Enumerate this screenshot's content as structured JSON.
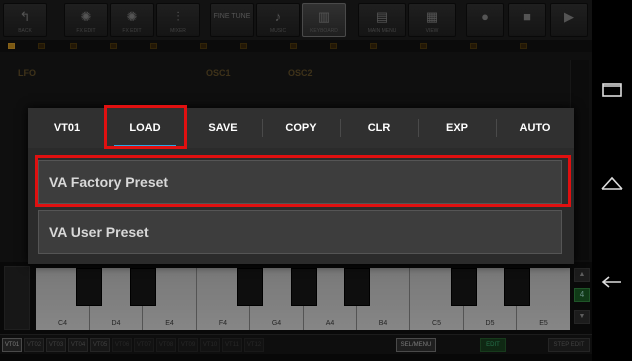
{
  "toolbar": {
    "buttons": [
      {
        "label": "BACK",
        "icon": "back-icon",
        "glyph": "↰"
      },
      {
        "label": "FX EDIT",
        "icon": "fx-icon",
        "glyph": "✺"
      },
      {
        "label": "FX EDIT",
        "icon": "fx2-icon",
        "glyph": "✺"
      },
      {
        "label": "MIXER",
        "icon": "mixer-icon",
        "glyph": "⫶"
      },
      {
        "label": "",
        "icon": "finetune-icon",
        "glyph": "FINE TUNE"
      },
      {
        "label": "MUSIC",
        "icon": "music-icon",
        "glyph": "♪"
      },
      {
        "label": "KEYBOARD",
        "icon": "keyboard-icon",
        "glyph": "▥"
      },
      {
        "label": "MAIN MENU",
        "icon": "mainmenu-icon",
        "glyph": "▤"
      },
      {
        "label": "VIEW",
        "icon": "view-icon",
        "glyph": "▦"
      },
      {
        "label": "",
        "icon": "record-icon",
        "glyph": "●"
      },
      {
        "label": "",
        "icon": "stop-icon",
        "glyph": "■"
      },
      {
        "label": "",
        "icon": "play-icon",
        "glyph": "▶"
      }
    ]
  },
  "background": {
    "lfo_label": "LFO",
    "osc1_label": "OSC1",
    "osc2_label": "OSC2"
  },
  "dialog": {
    "tabs": [
      "VT01",
      "LOAD",
      "SAVE",
      "COPY",
      "CLR",
      "EXP",
      "AUTO"
    ],
    "selected_tab": "LOAD",
    "items": [
      "VA Factory Preset",
      "VA User Preset"
    ],
    "accent": "#2aa7e4",
    "highlight": "#e01010"
  },
  "keyboard": {
    "keys": [
      "C4",
      "D4",
      "E4",
      "F4",
      "G4",
      "A4",
      "B4",
      "C5",
      "D5",
      "E5"
    ],
    "octave": "4"
  },
  "tracks": {
    "items": [
      "VT01",
      "VT02",
      "VT03",
      "VT04",
      "VT05",
      "VT06",
      "VT07",
      "VT08",
      "VT09",
      "VT10",
      "VT11",
      "VT12"
    ],
    "sel_menu": "SEL/MENU",
    "edit": "EDIT",
    "step_edit": "STEP EDIT"
  }
}
